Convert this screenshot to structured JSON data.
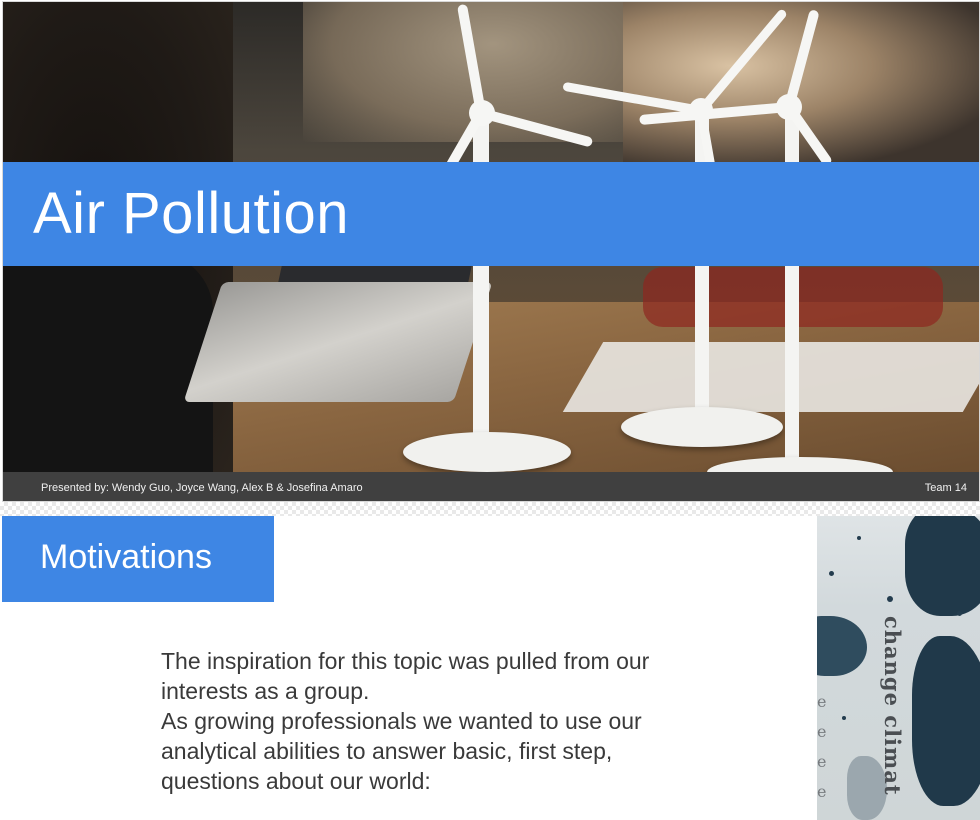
{
  "slide1": {
    "title": "Air Pollution",
    "presenters": "Presented by: Wendy Guo, Joyce Wang, Alex B  & Josefina Amaro",
    "team": "Team 14"
  },
  "slide2": {
    "heading": "Motivations",
    "paragraphs": [
      "The inspiration for this topic was pulled from our interests as a group.",
      "As growing  professionals we wanted to use our analytical abilities to answer basic, first step, questions about our world:"
    ],
    "poster_text": "change climat"
  },
  "colors": {
    "accent_blue": "#3e86e4",
    "footer_gray": "#404040",
    "body_text": "#3a3a3a"
  }
}
